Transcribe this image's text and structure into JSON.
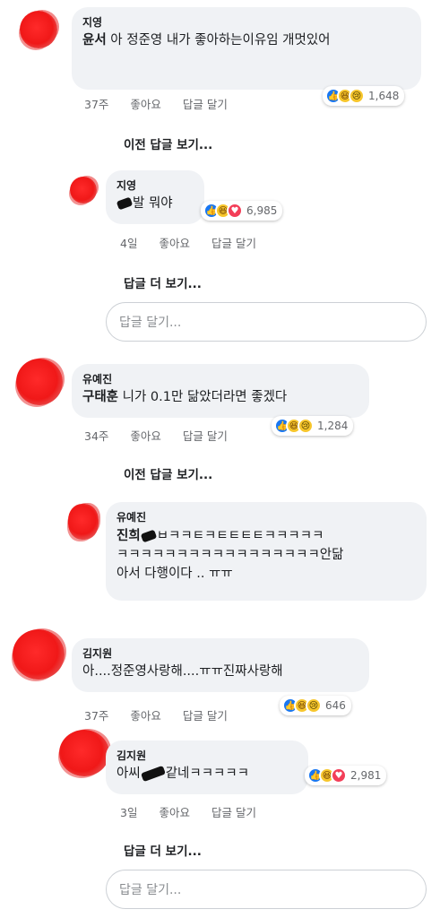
{
  "colors": {
    "bubble": "#f0f2f5",
    "link": "#1c1e21",
    "meta": "#65676b",
    "like": "#1877f2",
    "love": "#f33e58",
    "haha": "#f7c62c"
  },
  "threads": [
    {
      "comment": {
        "name": "지영",
        "tag": "윤서",
        "text": "아 정준영 내가 좋아하는이유임 개멋있어",
        "time": "37주",
        "like_label": "좋아요",
        "reply_label": "답글 달기",
        "count": "1,648",
        "reactions": [
          "like-icon",
          "haha-icon",
          "sad-icon"
        ]
      },
      "prev_replies": "이전 답글 보기...",
      "reply": {
        "name": "지영",
        "text_after": "발 뭐야",
        "time": "4일",
        "like_label": "좋아요",
        "reply_label": "답글 달기",
        "count": "6,985",
        "reactions": [
          "like-icon",
          "haha-icon",
          "love-icon"
        ]
      },
      "more_replies": "답글 더 보기...",
      "reply_placeholder": "답글 달기..."
    },
    {
      "comment": {
        "name": "유예진",
        "tag": "구태훈",
        "text": "니가 0.1만 닮았더라면 좋겠다",
        "time": "34주",
        "like_label": "좋아요",
        "reply_label": "답글 달기",
        "count": "1,284",
        "reactions": [
          "like-icon",
          "haha-icon",
          "sad-icon"
        ]
      },
      "prev_replies": "이전 답글 보기...",
      "reply": {
        "name": "유예진",
        "tag": "진희",
        "line1": "ㅂㅋㅋㅌㅋㅌㅌㅌㅌㅋㅋㅋㅋㅋ",
        "line2": "ㅋㅋㅋㅋㅋㅋㅋㅋㅋㅋㅋㅋㅋㅋㅋㅋㅋ안닮",
        "line3": "아서 다행이다 .. ㅠㅠ"
      }
    },
    {
      "comment": {
        "name": "김지원",
        "text": "아....정준영사랑해....ㅠㅠ진짜사랑해",
        "time": "37주",
        "like_label": "좋아요",
        "reply_label": "답글 달기",
        "count": "646",
        "reactions": [
          "like-icon",
          "haha-icon",
          "sad-icon"
        ]
      },
      "reply": {
        "name": "김지원",
        "text_before": "아씨",
        "text_after": "같네ㅋㅋㅋㅋㅋ",
        "time": "3일",
        "like_label": "좋아요",
        "reply_label": "답글 달기",
        "count": "2,981",
        "reactions": [
          "like-icon",
          "haha-icon",
          "love-icon"
        ]
      },
      "more_replies": "답글 더 보기...",
      "reply_placeholder": "답글 달기..."
    }
  ]
}
